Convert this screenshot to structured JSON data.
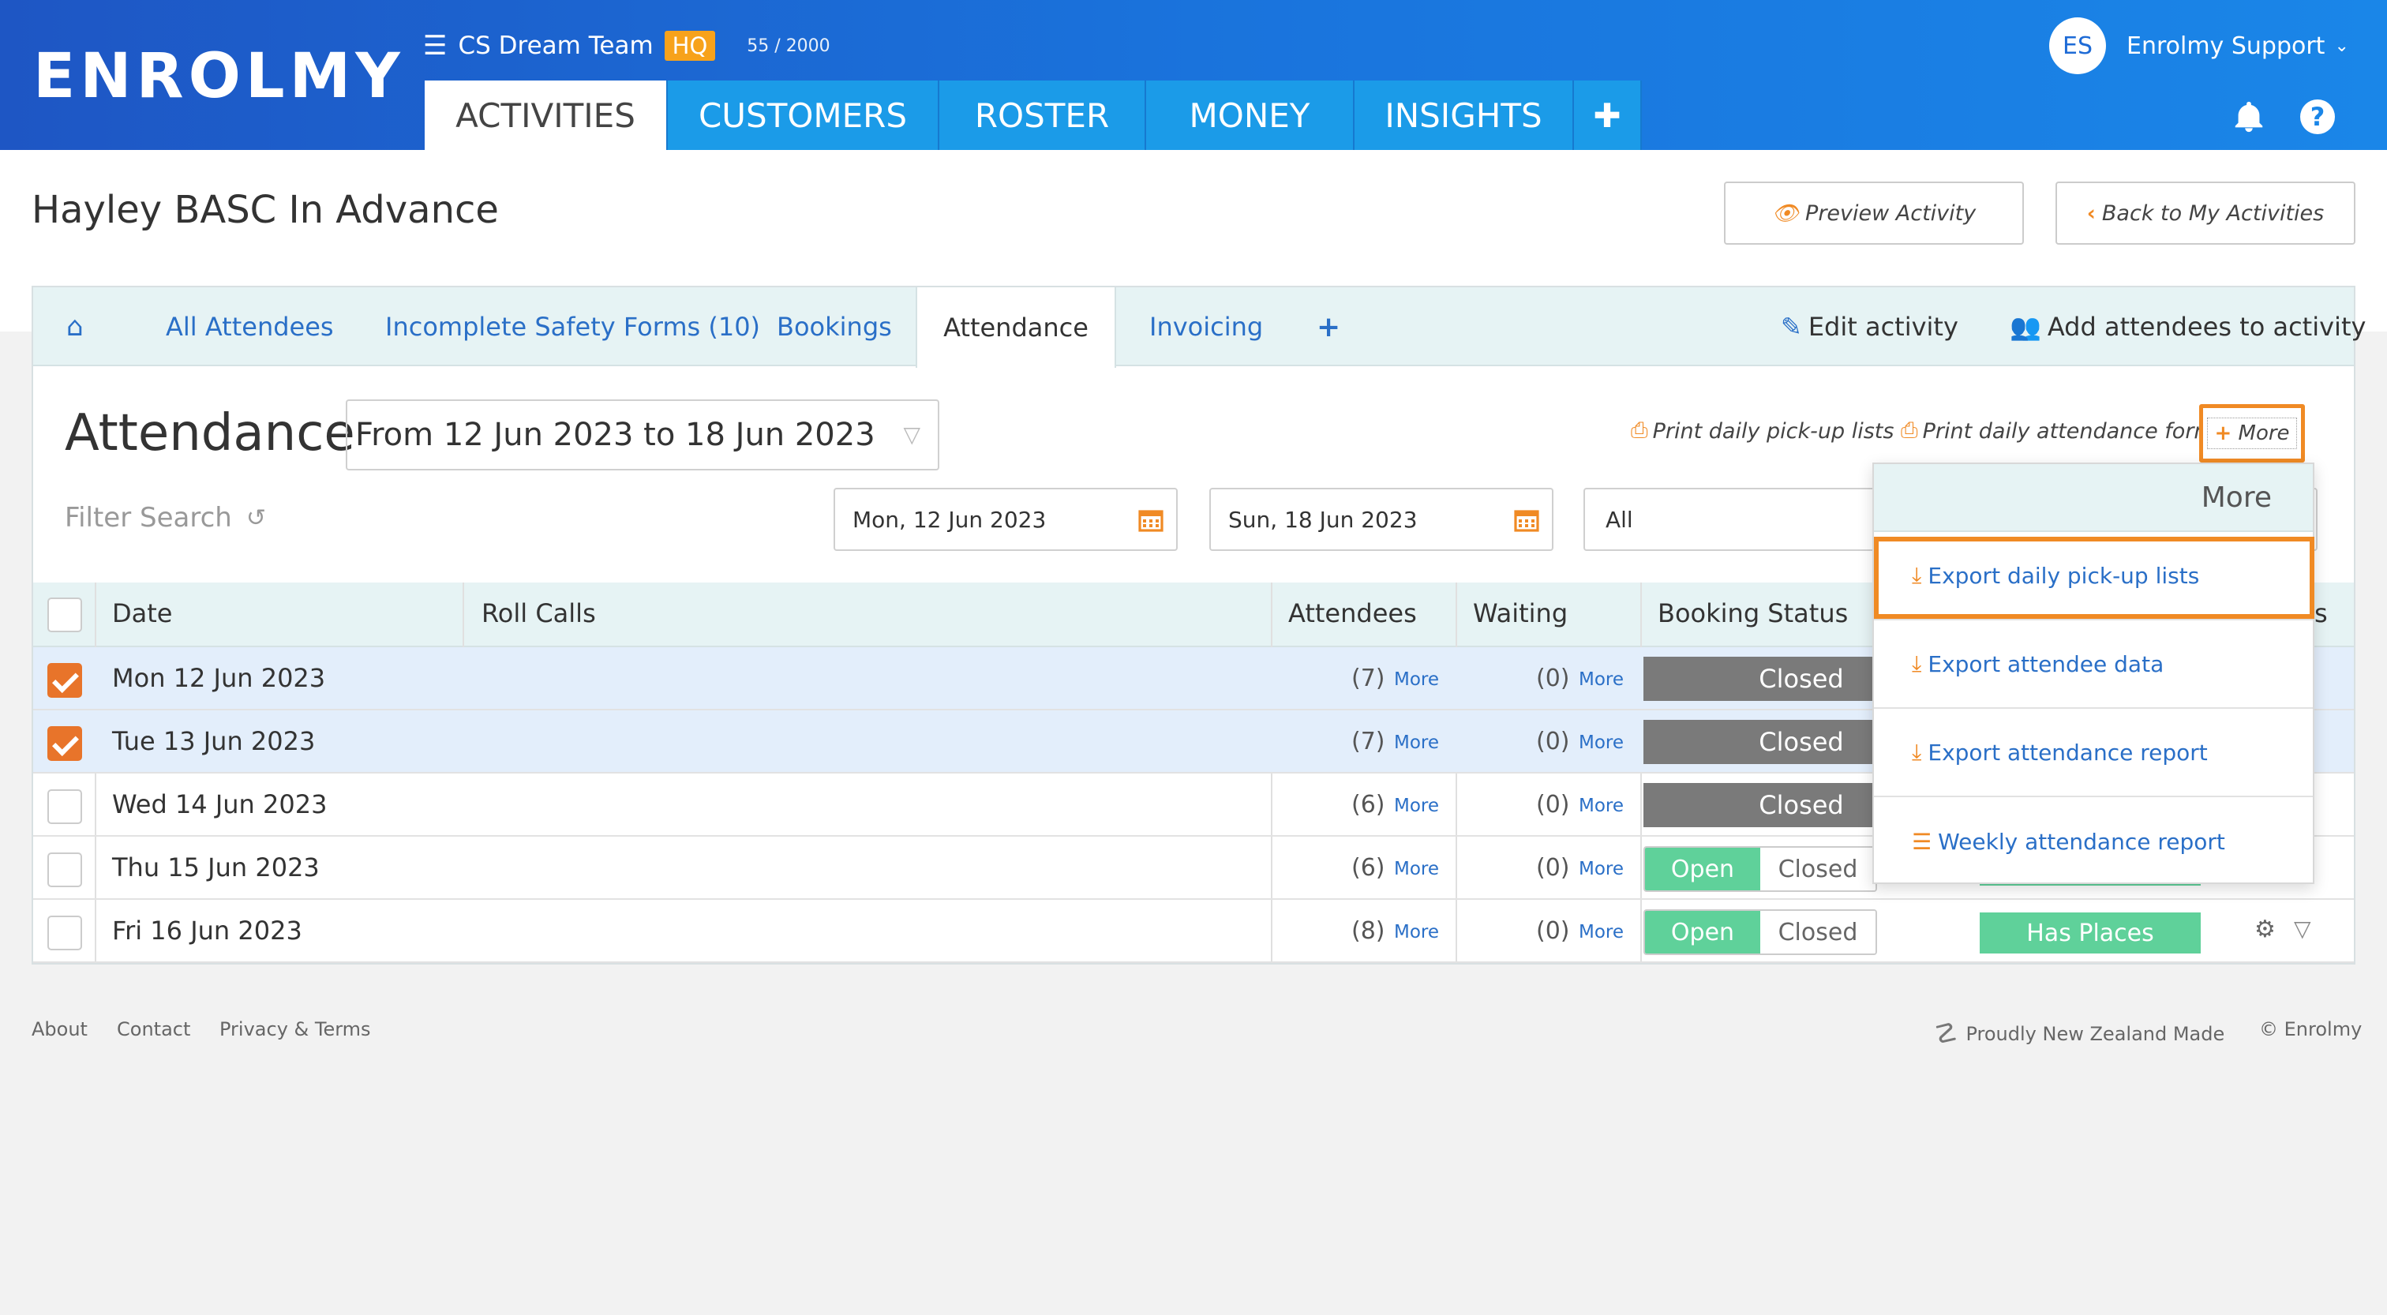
{
  "header": {
    "logo": "ENROLMY",
    "org_name": "CS Dream Team",
    "org_badge": "HQ",
    "count": "55 / 2000",
    "nav_tabs": [
      {
        "label": "ACTIVITIES"
      },
      {
        "label": "CUSTOMERS"
      },
      {
        "label": "ROSTER"
      },
      {
        "label": "MONEY"
      },
      {
        "label": "INSIGHTS"
      },
      {
        "label": "✚"
      }
    ],
    "user_initials": "ES",
    "user_name": "Enrolmy Support",
    "help_glyph": "?"
  },
  "page": {
    "title": "Hayley BASC In Advance",
    "preview_button": "Preview Activity",
    "back_button": "Back to My Activities"
  },
  "subnav": {
    "tabs": [
      {
        "label": "All Attendees"
      },
      {
        "label": "Incomplete Safety Forms (10)"
      },
      {
        "label": "Bookings"
      },
      {
        "label": "Attendance"
      },
      {
        "label": "Invoicing"
      }
    ],
    "edit_activity": "Edit activity",
    "add_attendees": "Add attendees to activity"
  },
  "attendance": {
    "title": "Attendance",
    "range": "From 12 Jun 2023 to 18 Jun 2023",
    "print_pickup": "Print daily pick-up lists",
    "print_form": "Print daily attendance form",
    "more_button": "More",
    "filter_placeholder": "Filter Search",
    "start_date": "Mon, 12 Jun 2023",
    "end_date": "Sun, 18 Jun 2023",
    "status_filter": "All"
  },
  "table": {
    "headers": {
      "date": "Date",
      "roll_calls": "Roll Calls",
      "attendees": "Attendees",
      "waiting": "Waiting",
      "booking_status": "Booking Status",
      "cut": "s"
    },
    "more_label": "More",
    "rows": [
      {
        "date": "Mon 12 Jun 2023",
        "attendees": "(7)",
        "waiting": "(0)",
        "status": "Closed",
        "selected": true
      },
      {
        "date": "Tue 13 Jun 2023",
        "attendees": "(7)",
        "waiting": "(0)",
        "status": "Closed",
        "selected": true
      },
      {
        "date": "Wed 14 Jun 2023",
        "attendees": "(6)",
        "waiting": "(0)",
        "status": "Closed",
        "selected": false
      },
      {
        "date": "Thu 15 Jun 2023",
        "attendees": "(6)",
        "waiting": "(0)",
        "open": "Open",
        "closed": "Closed",
        "selected": false
      },
      {
        "date": "Fri 16 Jun 2023",
        "attendees": "(8)",
        "waiting": "(0)",
        "open": "Open",
        "closed": "Closed",
        "places": "Has Places",
        "selected": false
      }
    ]
  },
  "dropdown": {
    "header": "More",
    "items": [
      {
        "label": "Export daily pick-up lists"
      },
      {
        "label": "Export attendee data"
      },
      {
        "label": "Export attendance report"
      },
      {
        "label": "Weekly attendance report"
      }
    ]
  },
  "footer": {
    "about": "About",
    "contact": "Contact",
    "privacy": "Privacy & Terms",
    "made": "Proudly New Zealand Made",
    "copyright": "© Enrolmy"
  },
  "colors": {
    "header_blue": "#1a73dc",
    "tab_blue": "#1b9be8",
    "accent_orange": "#f08a24",
    "open_green": "#5fd19a",
    "closed_grey": "#7a7a7a",
    "link_blue": "#2a6fc7"
  }
}
